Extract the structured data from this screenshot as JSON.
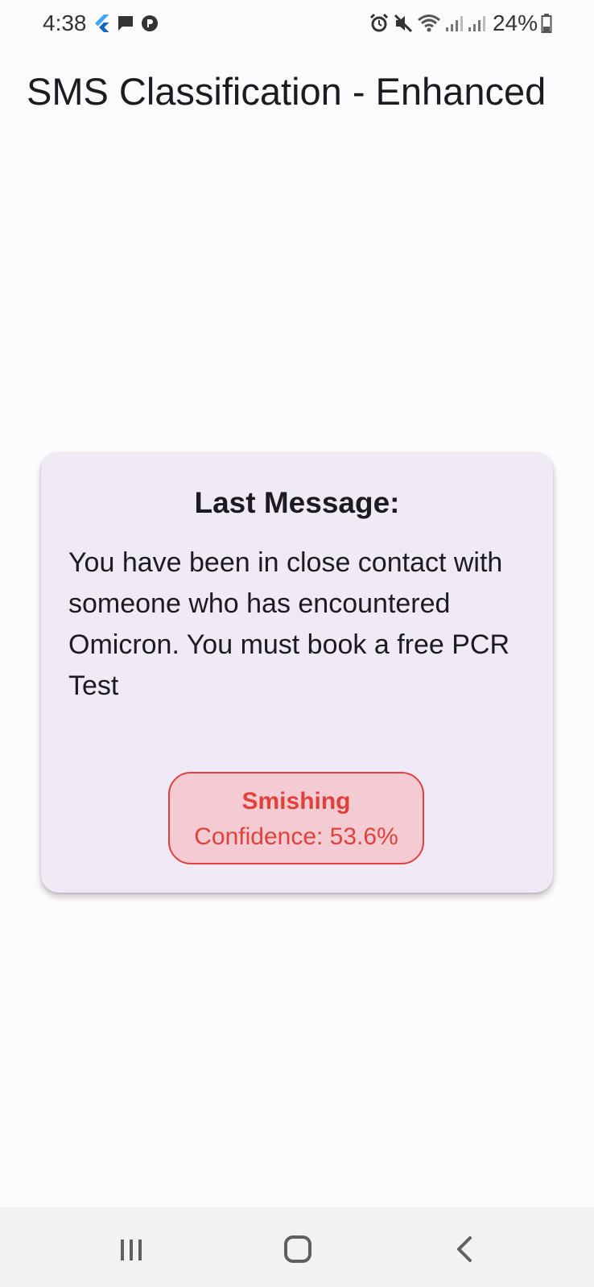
{
  "status_bar": {
    "time": "4:38",
    "battery": "24%",
    "left_icons": [
      "flutter-icon",
      "message-icon",
      "app-notification-icon"
    ],
    "right_icons": [
      "alarm-icon",
      "mute-icon",
      "wifi-icon",
      "signal-icon",
      "signal-icon",
      "battery-icon"
    ]
  },
  "app_bar": {
    "title": "SMS Classification - Enhanced"
  },
  "card": {
    "title": "Last Message:",
    "message": "You have been in close contact with someone who has encountered Omicron. You must book a free PCR\nTest",
    "result": {
      "label": "Smishing",
      "confidence": "Confidence: 53.6%",
      "color": "#e0413a",
      "background": "#f5cbd3"
    }
  },
  "nav_bar": {
    "buttons": [
      "recent-apps-button",
      "home-button",
      "back-button"
    ]
  },
  "colors": {
    "background": "#fefbff",
    "card": "#f0eaf7",
    "danger": "#e0413a"
  }
}
